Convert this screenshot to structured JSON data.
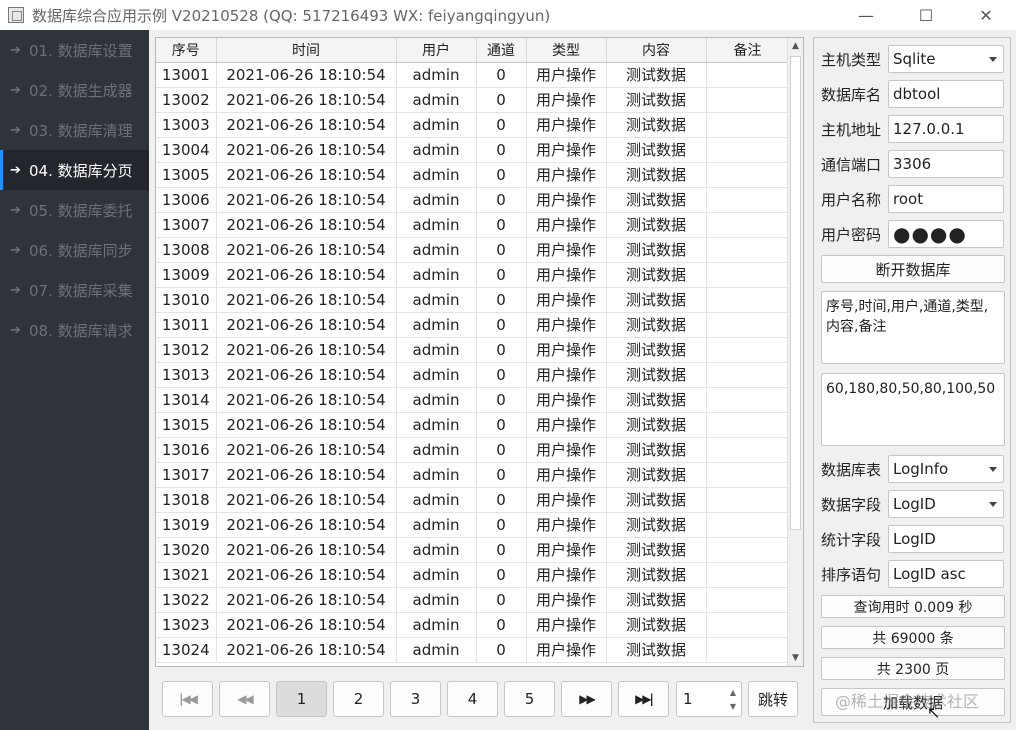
{
  "window": {
    "title": "数据库综合应用示例 V20210528 (QQ: 517216493 WX: feiyangqingyun)",
    "minimize": "—",
    "maximize": "☐",
    "close": "✕"
  },
  "sidebar": {
    "items": [
      {
        "label": "01. 数据库设置"
      },
      {
        "label": "02. 数据生成器"
      },
      {
        "label": "03. 数据库清理"
      },
      {
        "label": "04. 数据库分页"
      },
      {
        "label": "05. 数据库委托"
      },
      {
        "label": "06. 数据库同步"
      },
      {
        "label": "07. 数据库采集"
      },
      {
        "label": "08. 数据库请求"
      }
    ]
  },
  "table": {
    "columns": [
      "序号",
      "时间",
      "用户",
      "通道",
      "类型",
      "内容",
      "备注"
    ],
    "rows": [
      [
        "13001",
        "2021-06-26 18:10:54",
        "admin",
        "0",
        "用户操作",
        "测试数据",
        ""
      ],
      [
        "13002",
        "2021-06-26 18:10:54",
        "admin",
        "0",
        "用户操作",
        "测试数据",
        ""
      ],
      [
        "13003",
        "2021-06-26 18:10:54",
        "admin",
        "0",
        "用户操作",
        "测试数据",
        ""
      ],
      [
        "13004",
        "2021-06-26 18:10:54",
        "admin",
        "0",
        "用户操作",
        "测试数据",
        ""
      ],
      [
        "13005",
        "2021-06-26 18:10:54",
        "admin",
        "0",
        "用户操作",
        "测试数据",
        ""
      ],
      [
        "13006",
        "2021-06-26 18:10:54",
        "admin",
        "0",
        "用户操作",
        "测试数据",
        ""
      ],
      [
        "13007",
        "2021-06-26 18:10:54",
        "admin",
        "0",
        "用户操作",
        "测试数据",
        ""
      ],
      [
        "13008",
        "2021-06-26 18:10:54",
        "admin",
        "0",
        "用户操作",
        "测试数据",
        ""
      ],
      [
        "13009",
        "2021-06-26 18:10:54",
        "admin",
        "0",
        "用户操作",
        "测试数据",
        ""
      ],
      [
        "13010",
        "2021-06-26 18:10:54",
        "admin",
        "0",
        "用户操作",
        "测试数据",
        ""
      ],
      [
        "13011",
        "2021-06-26 18:10:54",
        "admin",
        "0",
        "用户操作",
        "测试数据",
        ""
      ],
      [
        "13012",
        "2021-06-26 18:10:54",
        "admin",
        "0",
        "用户操作",
        "测试数据",
        ""
      ],
      [
        "13013",
        "2021-06-26 18:10:54",
        "admin",
        "0",
        "用户操作",
        "测试数据",
        ""
      ],
      [
        "13014",
        "2021-06-26 18:10:54",
        "admin",
        "0",
        "用户操作",
        "测试数据",
        ""
      ],
      [
        "13015",
        "2021-06-26 18:10:54",
        "admin",
        "0",
        "用户操作",
        "测试数据",
        ""
      ],
      [
        "13016",
        "2021-06-26 18:10:54",
        "admin",
        "0",
        "用户操作",
        "测试数据",
        ""
      ],
      [
        "13017",
        "2021-06-26 18:10:54",
        "admin",
        "0",
        "用户操作",
        "测试数据",
        ""
      ],
      [
        "13018",
        "2021-06-26 18:10:54",
        "admin",
        "0",
        "用户操作",
        "测试数据",
        ""
      ],
      [
        "13019",
        "2021-06-26 18:10:54",
        "admin",
        "0",
        "用户操作",
        "测试数据",
        ""
      ],
      [
        "13020",
        "2021-06-26 18:10:54",
        "admin",
        "0",
        "用户操作",
        "测试数据",
        ""
      ],
      [
        "13021",
        "2021-06-26 18:10:54",
        "admin",
        "0",
        "用户操作",
        "测试数据",
        ""
      ],
      [
        "13022",
        "2021-06-26 18:10:54",
        "admin",
        "0",
        "用户操作",
        "测试数据",
        ""
      ],
      [
        "13023",
        "2021-06-26 18:10:54",
        "admin",
        "0",
        "用户操作",
        "测试数据",
        ""
      ],
      [
        "13024",
        "2021-06-26 18:10:54",
        "admin",
        "0",
        "用户操作",
        "测试数据",
        ""
      ]
    ]
  },
  "pager": {
    "pages": [
      "1",
      "2",
      "3",
      "4",
      "5"
    ],
    "current_page": "1",
    "jump_value": "1",
    "jump_label": "跳转"
  },
  "panel": {
    "host_type_label": "主机类型",
    "host_type_value": "Sqlite",
    "db_name_label": "数据库名",
    "db_name_value": "dbtool",
    "host_addr_label": "主机地址",
    "host_addr_value": "127.0.0.1",
    "port_label": "通信端口",
    "port_value": "3306",
    "user_label": "用户名称",
    "user_value": "root",
    "password_label": "用户密码",
    "password_mask": "●●●●",
    "disconnect_label": "断开数据库",
    "columns_text": "序号,时间,用户,通道,类型,内容,备注",
    "widths_text": "60,180,80,50,80,100,50",
    "db_table_label": "数据库表",
    "db_table_value": "LogInfo",
    "db_field_label": "数据字段",
    "db_field_value": "LogID",
    "count_field_label": "统计字段",
    "count_field_value": "LogID",
    "order_label": "排序语句",
    "order_value": "LogID asc",
    "query_time": "查询用时 0.009 秒",
    "total_records": "共 69000 条",
    "total_pages": "共 2300 页",
    "load_label": "加载数据"
  },
  "watermark": "@稀土掘金技术社区"
}
